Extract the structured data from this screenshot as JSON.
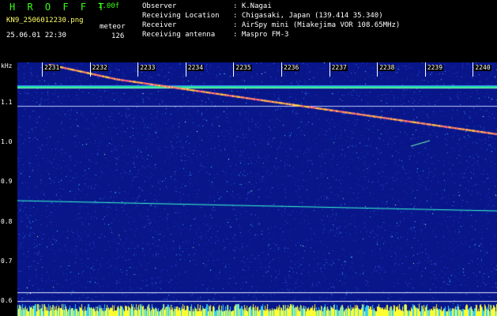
{
  "header": {
    "app_title": "H R O F F T",
    "version": "1.00f",
    "filename": "KN9_2506012230.png",
    "datetime": "25.06.01 22:30",
    "meteor_label": "meteor",
    "meteor_count": "126"
  },
  "info": {
    "observer_label": "Observer",
    "observer_value": ": K.Nagai",
    "location_label": "Receiving Location",
    "location_value": ": Chigasaki, Japan (139.414 35.340)",
    "receiver_label": "Receiver",
    "receiver_value": ": AirSpy mini (Miakejima VOR 108.65MHz)",
    "antenna_label": "Receiving antenna",
    "antenna_value": ": Maspro FM-3"
  },
  "axis": {
    "y_unit": "kHz",
    "y_ticks": [
      "1.1",
      "1.0",
      "0.9",
      "0.8",
      "0.7",
      "0.6"
    ],
    "x_ticks": [
      "2231",
      "2232",
      "2233",
      "2234",
      "2235",
      "2236",
      "2237",
      "2238",
      "2239",
      "2240"
    ]
  },
  "colors": {
    "background": "#000000",
    "plot_bg": "#0a1a8c",
    "header_green": "#39ff14",
    "header_yellow": "#ffff66"
  }
}
